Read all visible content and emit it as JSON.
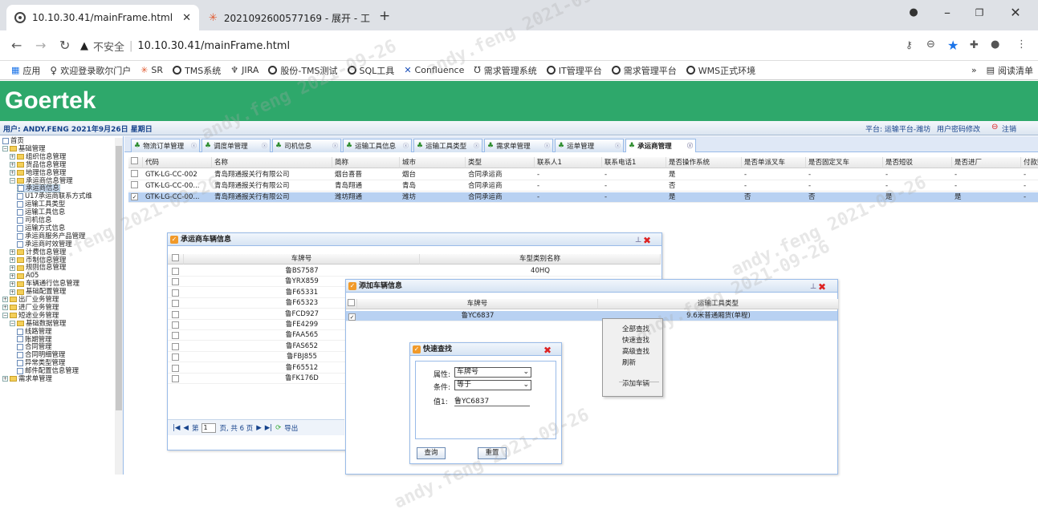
{
  "browser": {
    "tabs": [
      {
        "title": "10.10.30.41/mainFrame.html",
        "active": true
      },
      {
        "title": "2021092600577169 - 展开 - 工",
        "active": false
      }
    ],
    "new_tab": "+",
    "url_warning": "不安全",
    "url": "10.10.30.41/mainFrame.html",
    "bookmarks": [
      "应用",
      "欢迎登录歌尔门户",
      "SR",
      "TMS系统",
      "JIRA",
      "股份-TMS测试",
      "SQL工具",
      "Confluence",
      "需求管理系统",
      "IT管理平台",
      "需求管理平台",
      "WMS正式环境"
    ],
    "more_bookmarks": "»",
    "reading_list": "阅读清单"
  },
  "app": {
    "logo": "Goertek",
    "user_info": "用户: ANDY.FENG 2021年9月26日 星期日",
    "platform": "平台: 运输平台-潍坊",
    "change_password": "用户密码修改",
    "logout": "注销",
    "watermark": "andy.feng 2021-09-26"
  },
  "sidebar": {
    "items": [
      {
        "label": "首页",
        "level": 0,
        "type": "leaf"
      },
      {
        "label": "基础管理",
        "level": 0,
        "type": "folder-open"
      },
      {
        "label": "组织信息管理",
        "level": 1,
        "type": "folder"
      },
      {
        "label": "货品信息管理",
        "level": 1,
        "type": "folder"
      },
      {
        "label": "地理信息管理",
        "level": 1,
        "type": "folder"
      },
      {
        "label": "承运商信息管理",
        "level": 1,
        "type": "folder-open"
      },
      {
        "label": "承运商信息",
        "level": 2,
        "type": "leaf",
        "selected": true
      },
      {
        "label": "U17承运商联系方式维",
        "level": 2,
        "type": "leaf"
      },
      {
        "label": "运输工具类型",
        "level": 2,
        "type": "leaf"
      },
      {
        "label": "运输工具信息",
        "level": 2,
        "type": "leaf"
      },
      {
        "label": "司机信息",
        "level": 2,
        "type": "leaf"
      },
      {
        "label": "运输方式信息",
        "level": 2,
        "type": "leaf"
      },
      {
        "label": "承运商服务产品管理",
        "level": 2,
        "type": "leaf"
      },
      {
        "label": "承运商时效管理",
        "level": 2,
        "type": "leaf"
      },
      {
        "label": "计费信息管理",
        "level": 1,
        "type": "folder"
      },
      {
        "label": "币制信息管理",
        "level": 1,
        "type": "folder"
      },
      {
        "label": "规则信息管理",
        "level": 1,
        "type": "folder"
      },
      {
        "label": "A05",
        "level": 1,
        "type": "folder"
      },
      {
        "label": "车辆通行信息管理",
        "level": 1,
        "type": "folder"
      },
      {
        "label": "基础配置管理",
        "level": 1,
        "type": "folder"
      },
      {
        "label": "出厂业务管理",
        "level": 0,
        "type": "folder"
      },
      {
        "label": "进厂业务管理",
        "level": 0,
        "type": "folder"
      },
      {
        "label": "短途业务管理",
        "level": 0,
        "type": "folder-open"
      },
      {
        "label": "基础数据管理",
        "level": 1,
        "type": "folder-open"
      },
      {
        "label": "线路管理",
        "level": 2,
        "type": "leaf"
      },
      {
        "label": "账期管理",
        "level": 2,
        "type": "leaf"
      },
      {
        "label": "合同管理",
        "level": 2,
        "type": "leaf"
      },
      {
        "label": "合同明细管理",
        "level": 2,
        "type": "leaf"
      },
      {
        "label": "异常类型管理",
        "level": 2,
        "type": "leaf"
      },
      {
        "label": "邮件配置信息管理",
        "level": 2,
        "type": "leaf"
      },
      {
        "label": "需求单管理",
        "level": 0,
        "type": "folder"
      }
    ]
  },
  "main_tabs": [
    "物流订单管理",
    "调度单管理",
    "司机信息",
    "运输工具信息",
    "运输工具类型",
    "需求单管理",
    "运单管理",
    "承运商管理"
  ],
  "grid": {
    "columns": [
      "代码",
      "名称",
      "简称",
      "城市",
      "类型",
      "联系人1",
      "联系电话1",
      "是否操作系统",
      "是否单派叉车",
      "是否固定叉车",
      "是否短驳",
      "是否进厂",
      "付款账"
    ],
    "rows": [
      {
        "checked": false,
        "selected": false,
        "cells": [
          "GTK-LG-CC-002",
          "青岛翔通报关行有限公司",
          "烟台喜晋",
          "烟台",
          "合同承运商",
          "-",
          "-",
          "是",
          "-",
          "-",
          "-",
          "-",
          "-"
        ]
      },
      {
        "checked": false,
        "selected": false,
        "cells": [
          "GTK-LG-CC-00...",
          "青岛翔通报关行有限公司",
          "青岛翔通",
          "青岛",
          "合同承运商",
          "-",
          "-",
          "否",
          "-",
          "-",
          "-",
          "-",
          "-"
        ]
      },
      {
        "checked": true,
        "selected": true,
        "cells": [
          "GTK-LG-CC-00...",
          "青岛翔通报关行有限公司",
          "潍坊翔通",
          "潍坊",
          "合同承运商",
          "-",
          "-",
          "是",
          "否",
          "否",
          "是",
          "是",
          "-"
        ]
      }
    ]
  },
  "vehicle_window": {
    "title": "承运商车辆信息",
    "columns": [
      "车牌号",
      "车型类别名称"
    ],
    "rows": [
      [
        "鲁BS7587",
        "40HQ"
      ],
      [
        "鲁YRX859",
        ""
      ],
      [
        "鲁F65331",
        ""
      ],
      [
        "鲁F65323",
        ""
      ],
      [
        "鲁FCD927",
        ""
      ],
      [
        "鲁FE4299",
        ""
      ],
      [
        "鲁FAA565",
        ""
      ],
      [
        "鲁FAS652",
        ""
      ],
      [
        "鲁FBJ855",
        ""
      ],
      [
        "鲁F65512",
        ""
      ],
      [
        "鲁FK176D",
        ""
      ]
    ],
    "pager": {
      "page_label": "第",
      "page": "1",
      "total": "页, 共 6 页",
      "export": "导出"
    }
  },
  "add_window": {
    "title": "添加车辆信息",
    "columns": [
      "车牌号",
      "运输工具类型"
    ],
    "rows": [
      {
        "checked": true,
        "plate": "鲁YC6837",
        "type": "9.6米普通厢货(单程)"
      }
    ]
  },
  "context_menu": {
    "items": [
      "全部查找",
      "快速查找",
      "高级查找",
      "刷新",
      "添加车辆"
    ]
  },
  "quick_search": {
    "title": "快速查找",
    "attr_label": "属性:",
    "attr_value": "车牌号",
    "cond_label": "条件:",
    "cond_value": "等于",
    "value_label": "值1:",
    "value": "鲁YC6837",
    "search_button": "查询",
    "reset_button": "重置"
  }
}
